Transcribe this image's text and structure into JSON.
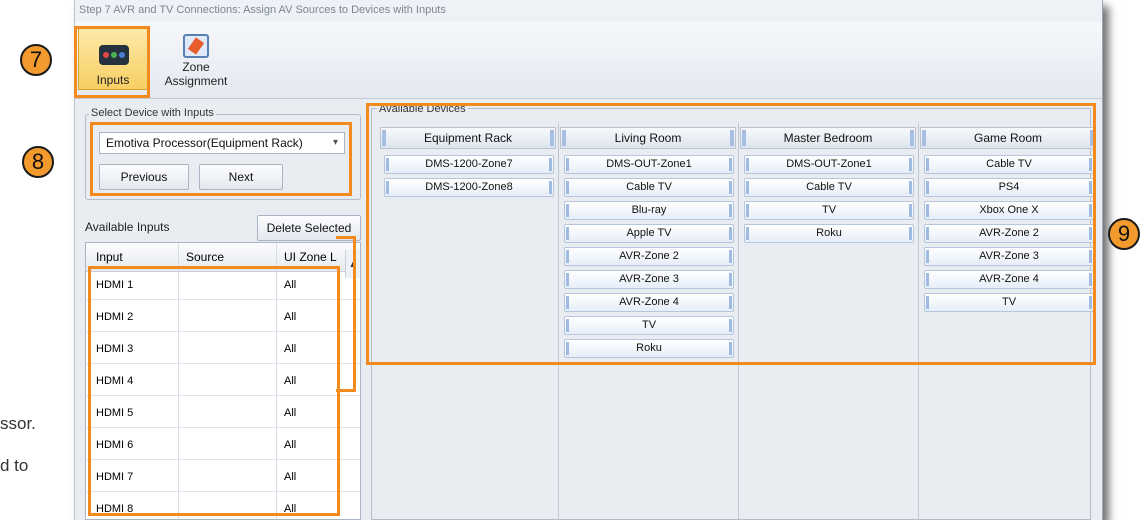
{
  "window_title": "Step 7 AVR and TV Connections: Assign AV Sources to Devices with Inputs",
  "ribbon": {
    "inputs_label": "Inputs",
    "zone_label": "Zone Assignment"
  },
  "callouts": {
    "c7": "7",
    "c8": "8",
    "c9": "9"
  },
  "doc_text": {
    "line1": "ssor.",
    "line2": "d to"
  },
  "select_device": {
    "group_label": "Select Device with Inputs",
    "selected": "Emotiva Processor(Equipment Rack)",
    "previous": "Previous",
    "next": "Next"
  },
  "available_inputs": {
    "label": "Available Inputs",
    "delete_button": "Delete Selected",
    "columns": [
      "Input",
      "Source",
      "UI Zone L"
    ],
    "rows": [
      {
        "input": "HDMI 1",
        "source": "",
        "zone": "All"
      },
      {
        "input": "HDMI 2",
        "source": "",
        "zone": "All"
      },
      {
        "input": "HDMI 3",
        "source": "",
        "zone": "All"
      },
      {
        "input": "HDMI 4",
        "source": "",
        "zone": "All"
      },
      {
        "input": "HDMI 5",
        "source": "",
        "zone": "All"
      },
      {
        "input": "HDMI 6",
        "source": "",
        "zone": "All"
      },
      {
        "input": "HDMI 7",
        "source": "",
        "zone": "All"
      },
      {
        "input": "HDMI 8",
        "source": "",
        "zone": "All"
      }
    ]
  },
  "available_devices": {
    "label": "Available Devices",
    "rooms": [
      {
        "name": "Equipment Rack",
        "devices": [
          "DMS-1200-Zone7",
          "DMS-1200-Zone8"
        ]
      },
      {
        "name": "Living Room",
        "devices": [
          "DMS-OUT-Zone1",
          "Cable TV",
          "Blu-ray",
          "Apple TV",
          "AVR-Zone 2",
          "AVR-Zone 3",
          "AVR-Zone 4",
          "TV",
          "Roku"
        ]
      },
      {
        "name": "Master Bedroom",
        "devices": [
          "DMS-OUT-Zone1",
          "Cable TV",
          "TV",
          "Roku"
        ]
      },
      {
        "name": "Game Room",
        "devices": [
          "Cable TV",
          "PS4",
          "Xbox One X",
          "AVR-Zone 2",
          "AVR-Zone 3",
          "AVR-Zone 4",
          "TV"
        ]
      }
    ]
  },
  "colors": {
    "callout": "#f29a2e",
    "highlight": "#f28a1e",
    "window_bg": "#e9ecf1"
  }
}
